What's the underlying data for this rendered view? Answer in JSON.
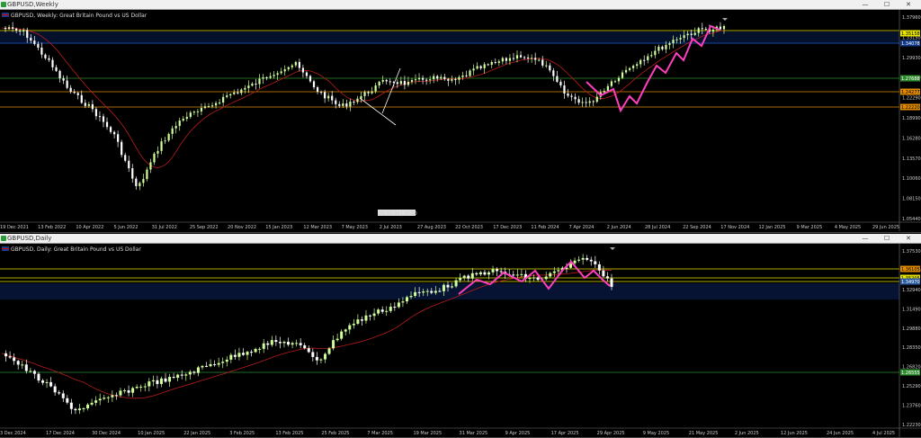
{
  "colors": {
    "bull": "#cfff9a",
    "bear": "#ffffff",
    "ma": "#b91c1c",
    "wave": "#ff3fbf",
    "yellow": "#e6e600",
    "orange": "#e08a00",
    "green": "#2e8b2e",
    "navy": "#123a8a"
  },
  "weekly": {
    "title": "GBPUSD,Weekly",
    "symbol_label": "GBPUSD, Weekly:  Great Britain Pound vs US Dollar",
    "price_labels": [
      "1.37960",
      "1.33150",
      "1.29930",
      "1.26110",
      "1.22290",
      "1.18990",
      "1.16280",
      "1.13570",
      "1.10060",
      "1.08150",
      "1.05440"
    ],
    "price_boxes": [
      {
        "text": "1.35158",
        "color": "#e6e600",
        "fg": "#000"
      },
      {
        "text": "1.34078",
        "color": "#123a8a",
        "fg": "#fff"
      },
      {
        "text": "1.27688",
        "color": "#2e8b2e",
        "fg": "#fff"
      },
      {
        "text": "1.24277",
        "color": "#e08a00",
        "fg": "#000"
      },
      {
        "text": "1.22220",
        "color": "#e08a00",
        "fg": "#000"
      }
    ],
    "date_labels": [
      "19 Dec 2021",
      "13 Feb 2022",
      "10 Apr 2022",
      "5 Jun 2022",
      "31 Jul 2022",
      "25 Sep 2022",
      "20 Nov 2022",
      "15 Jan 2023",
      "12 Mar 2023",
      "7 May 2023",
      "2 Jul 2023",
      "27 Aug 2023",
      "22 Oct 2023",
      "17 Dec 2023",
      "11 Feb 2024",
      "7 Apr 2024",
      "2 Jun 2024",
      "28 Jul 2024",
      "22 Sep 2024",
      "17 Nov 2024",
      "12 Jan 2025",
      "9 Mar 2025",
      "4 May 2025",
      "29 Jun 2025"
    ],
    "crosshair_label": "21 10:00 | 20:00"
  },
  "daily": {
    "title": "GBPUSD,Daily",
    "symbol_label": "GBPUSD, Daily:  Great Britain Pound vs US Dollar",
    "price_labels": [
      "1.37530",
      "1.33430",
      "1.32940",
      "1.31490",
      "1.29880",
      "1.28350",
      "1.26820",
      "1.25290",
      "1.23760",
      "1.22230"
    ],
    "price_boxes": [
      {
        "text": "1.36105",
        "color": "#e08a00",
        "fg": "#000"
      },
      {
        "text": "1.35205",
        "color": "#e6e600",
        "fg": "#000"
      },
      {
        "text": "1.34970",
        "color": "#2a5aa0",
        "fg": "#fff"
      },
      {
        "text": "1.26555",
        "color": "#2e8b2e",
        "fg": "#fff"
      }
    ],
    "date_labels": [
      "3 Dec 2024",
      "17 Dec 2024",
      "30 Dec 2024",
      "10 Jan 2025",
      "22 Jan 2025",
      "3 Feb 2025",
      "13 Feb 2025",
      "25 Feb 2025",
      "7 Mar 2025",
      "19 Mar 2025",
      "31 Mar 2025",
      "9 Apr 2025",
      "17 Apr 2025",
      "29 Apr 2025",
      "9 May 2025",
      "21 May 2025",
      "2 Jun 2025",
      "12 Jun 2025",
      "24 Jun 2025",
      "4 Jul 2025"
    ]
  },
  "window_buttons": {
    "min": "—",
    "max": "☐",
    "close": "✕"
  }
}
